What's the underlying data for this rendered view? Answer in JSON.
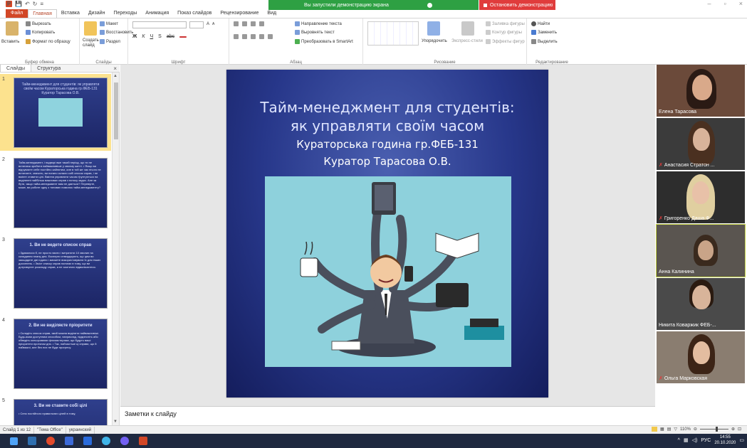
{
  "app": {
    "quick_access": [
      "💾",
      "↶",
      "↻",
      "≡"
    ]
  },
  "share": {
    "status_text": "Вы запустили демонстрацию экрана",
    "stop_label": "Остановить демонстрацию"
  },
  "ribbon_tabs": [
    "Файл",
    "Главная",
    "Вставка",
    "Дизайн",
    "Переходы",
    "Анимация",
    "Показ слайдов",
    "Рецензирование",
    "Вид"
  ],
  "ribbon": {
    "clipboard": {
      "paste": "Вставить",
      "cut": "Вырезать",
      "copy": "Копировать",
      "format": "Формат по образцу",
      "label": "Буфер обмена"
    },
    "slides": {
      "create": "Создать слайд",
      "layout": "Макет",
      "reset": "Восстановить",
      "section": "Раздел",
      "label": "Слайды"
    },
    "font": {
      "label": "Шрифт",
      "b": "Ж",
      "i": "К",
      "u": "Ч",
      "s": "S",
      "abc": "abc",
      "size_up": "A",
      "size_down": "A"
    },
    "paragraph": {
      "label": "Абзац",
      "dir": "Направление текста",
      "align": "Выровнять текст",
      "smartart": "Преобразовать в SmartArt"
    },
    "drawing": {
      "label": "Рисование",
      "arrange": "Упорядочить",
      "quick": "Экспресс-стили",
      "fill": "Заливка фигуры",
      "outline": "Контур фигуры",
      "effects": "Эффекты фигур"
    },
    "editing": {
      "label": "Редактирование",
      "find": "Найти",
      "replace": "Заменить",
      "select": "Выделить"
    }
  },
  "left_pane": {
    "tab_slides": "Слайды",
    "tab_outline": "Структура",
    "close": "×",
    "thumbs": [
      {
        "num": "1",
        "title": "Тайм-менеджмент для студентів: як управляти своїм часом Кураторська година гр.ФЕБ-131 Куратор Тарасова О.В."
      },
      {
        "num": "2",
        "body": "Тайм-менеджмент, і надворі вже такий період, що ти не встигаєш зробити найважливіше у своєму житті. • Якщо ви відчуваєте себе постійно зайнятим, але в той же час нічого не встигаєте, значить, ви погано склали собі список справ, і не вмієте ставити цілі. Вміння управляти часом ґрунтується на виділенні найбільш важливих справ з потоку задач. Але як бути, якщо тайм-менеджмент вам не дається? Перевірте, може, ви робите одну з типових помилок тайм-менеджменту?"
      },
      {
        "num": "3",
        "head": "1. Ви не ведете список справ",
        "body": "• Здавалося б, не просто взяти і витратити 10 хвилин на складання плану дня. Експерти стверджують, що цим ви заощадите дві години і зможете використовувати їх для інших досягнень. • Зміст списку справ полягає в тому, що ви дотримуєте розкладу справ, а не хаотично відволікаєтеся."
      },
      {
        "num": "4",
        "head": "2. Ви не виділяєте пріоритети",
        "body": "• Складіть список справ, який можна виділити найважливіші. Будь-яким доступним способом, наприклад, підкресліть або обведіть кольоровими фломастерами, що будуть ваші пріоритети протягом дня. • Так, найчастіше ці справи, що й найважчі, але без них не буде прогресу."
      },
      {
        "num": "5",
        "head": "3. Ви не ставите собі цілі",
        "body": "• Сенс постійного правильних цілей в тому,"
      }
    ]
  },
  "slide": {
    "title_line1": "Тайм-менеджмент для студентів:",
    "title_line2": "як управляти своїм часом",
    "sub1": "Кураторська година гр.ФЕБ-131",
    "sub2": "Куратор Тарасова О.В."
  },
  "notes": {
    "placeholder": "Заметки к слайду"
  },
  "participants": [
    {
      "name": "Елена Тарасова",
      "muted": false,
      "active": false,
      "bg": "#6b4a3a"
    },
    {
      "name": "Анастасия Стратон ...",
      "muted": true,
      "active": false,
      "bg": "#3b3b3b"
    },
    {
      "name": "Григоренко Даша Ф...",
      "muted": true,
      "active": false,
      "bg": "#2d2d2d"
    },
    {
      "name": "Анна Калинина",
      "muted": false,
      "active": true,
      "bg": "#5a5550"
    },
    {
      "name": "Никита Коваржик ФЕБ-...",
      "muted": false,
      "active": false,
      "bg": "#4a4a4a"
    },
    {
      "name": "Ольга Марковская",
      "muted": true,
      "active": false,
      "bg": "#8a7d70"
    }
  ],
  "status": {
    "slide": "Слайд 1 из 12",
    "theme": "\"Тема Office\"",
    "lang": "украинский",
    "zoom": "110%"
  },
  "tray": {
    "lang": "РУС",
    "time": "14:55",
    "date": "20.10.2020"
  }
}
